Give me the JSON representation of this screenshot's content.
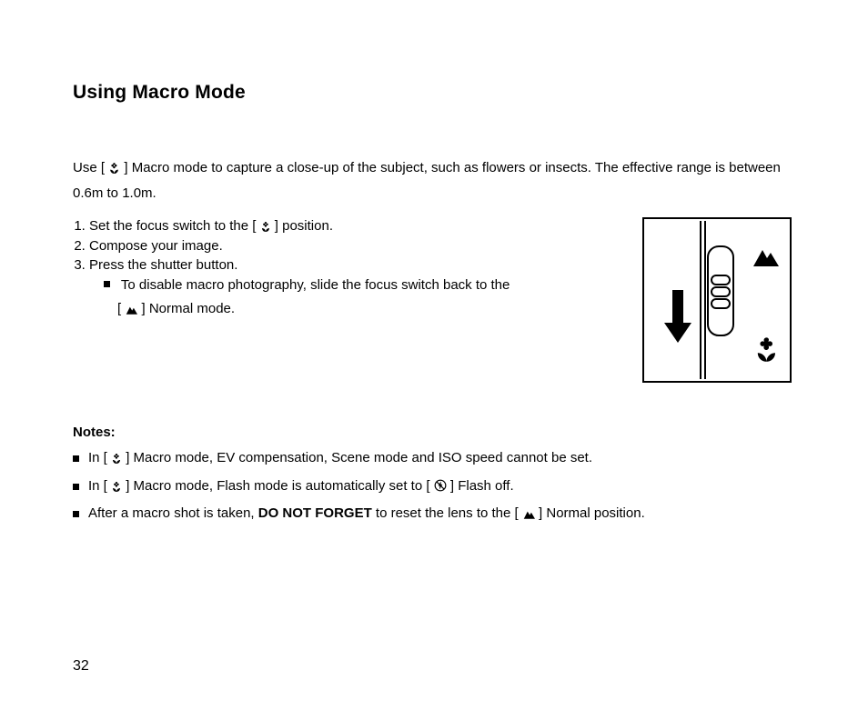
{
  "title": "Using Macro Mode",
  "intro_a": "Use [",
  "intro_b": "] Macro mode to capture a close-up of the subject, such as flowers or insects. The effective range is between 0.6m to 1.0m.",
  "steps": {
    "s1a": "Set the focus switch to the [",
    "s1b": "] position.",
    "s2": "Compose your image.",
    "s3": "Press the shutter button.",
    "s3_sub_a": "To disable macro photography, slide the focus switch back to the",
    "s3_sub_b": "[",
    "s3_sub_c": "] Normal mode."
  },
  "notes": {
    "label": "Notes:",
    "n1a": "In [",
    "n1b": "] Macro mode, EV compensation, Scene mode and ISO speed cannot be set.",
    "n2a": "In [",
    "n2b": "] Macro mode, Flash mode is automatically set to [",
    "n2c": "] Flash off.",
    "n3a": "After a macro shot is taken, ",
    "n3b": "DO NOT FORGET",
    "n3c": " to reset the lens to the  [",
    "n3d": "] Normal position."
  },
  "page_number": "32"
}
